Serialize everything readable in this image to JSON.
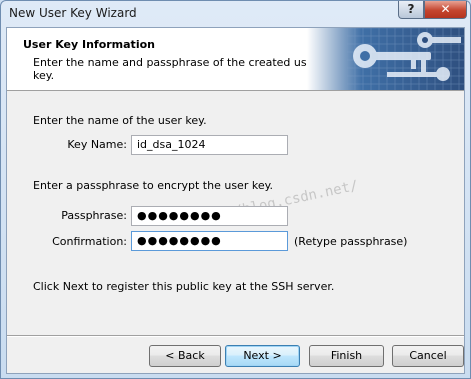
{
  "window": {
    "title": "New User Key Wizard",
    "help_label": "?",
    "close_label": "✕"
  },
  "header": {
    "title": "User Key Information",
    "description": "Enter the name and passphrase of the created user key."
  },
  "form": {
    "name_prompt": "Enter the name of the user key.",
    "key_name_label": "Key Name:",
    "key_name_value": "id_dsa_1024",
    "pass_prompt": "Enter a passphrase to encrypt the user key.",
    "passphrase_label": "Passphrase:",
    "passphrase_value": "●●●●●●●●",
    "confirmation_label": "Confirmation:",
    "confirmation_value": "●●●●●●●●",
    "retype_hint": "(Retype passphrase)",
    "register_note": "Click Next to register this public key at the SSH server."
  },
  "watermark": "http://blog.csdn.net/",
  "buttons": {
    "back": "< Back",
    "next": "Next >",
    "finish": "Finish",
    "cancel": "Cancel"
  },
  "colors": {
    "accent": "#2e4f7f",
    "focus_border": "#5b9ad9"
  }
}
